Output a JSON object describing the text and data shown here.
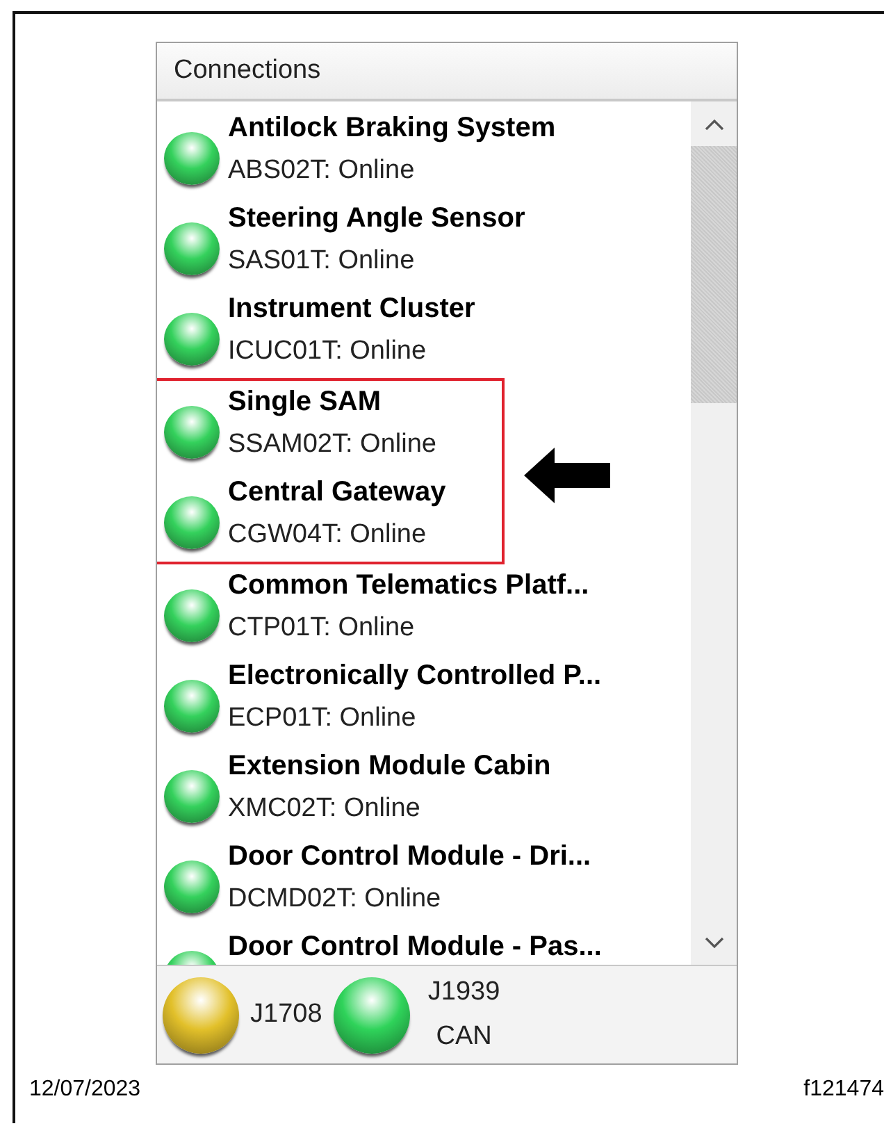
{
  "panel": {
    "title": "Connections",
    "connections": [
      {
        "name": "Antilock Braking System",
        "status": "ABS02T: Online",
        "highlighted": false
      },
      {
        "name": "Steering Angle Sensor",
        "status": "SAS01T: Online",
        "highlighted": false
      },
      {
        "name": "Instrument Cluster",
        "status": "ICUC01T: Online",
        "highlighted": false
      },
      {
        "name": "Single SAM",
        "status": "SSAM02T: Online",
        "highlighted": true
      },
      {
        "name": "Central Gateway",
        "status": "CGW04T: Online",
        "highlighted": true
      },
      {
        "name": "Common Telematics Platf...",
        "status": "CTP01T: Online",
        "highlighted": false
      },
      {
        "name": "Electronically Controlled P...",
        "status": "ECP01T: Online",
        "highlighted": false
      },
      {
        "name": "Extension Module Cabin",
        "status": "XMC02T: Online",
        "highlighted": false
      },
      {
        "name": "Door Control Module - Dri...",
        "status": "DCMD02T: Online",
        "highlighted": false
      },
      {
        "name": "Door Control Module - Pas...",
        "highlighted": false
      }
    ],
    "buses": [
      {
        "label": "J1708",
        "color": "#e2c02a"
      },
      {
        "label": "J1939 CAN",
        "color": "#2fd35a"
      }
    ]
  },
  "footer": {
    "date": "12/07/2023",
    "figure_id": "f121474"
  }
}
